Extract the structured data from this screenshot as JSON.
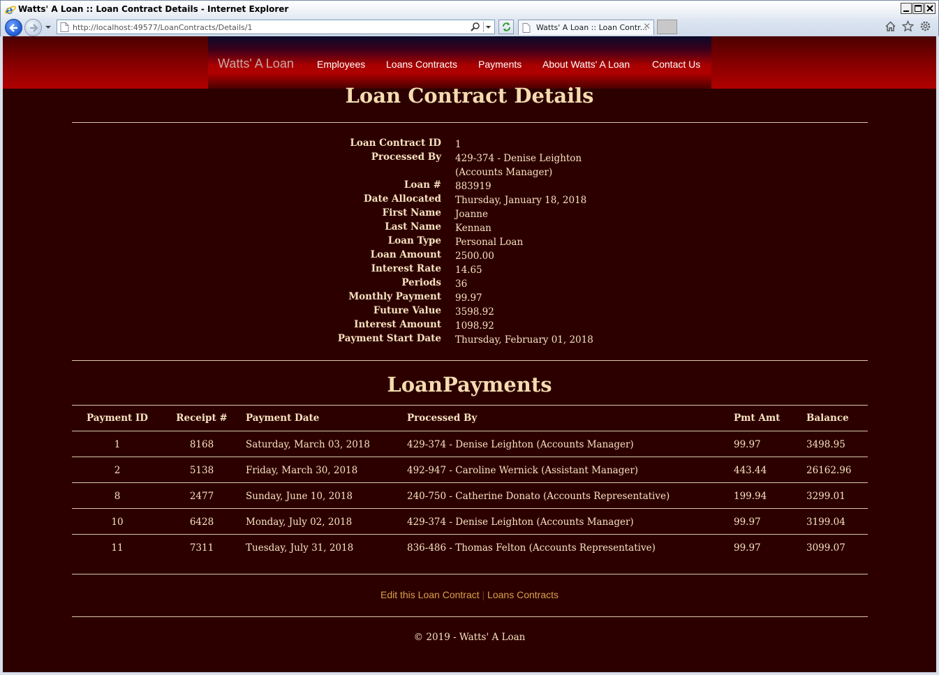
{
  "window": {
    "title": "Watts' A Loan :: Loan Contract Details - Internet Explorer",
    "url": "http://localhost:49577/LoanContracts/Details/1",
    "tab_title": "Watts' A Loan :: Loan Contr...",
    "tab_close": "✕"
  },
  "nav": {
    "brand": "Watts' A Loan",
    "items": [
      {
        "label": "Employees"
      },
      {
        "label": "Loans Contracts"
      },
      {
        "label": "Payments"
      },
      {
        "label": "About Watts' A Loan"
      },
      {
        "label": "Contact Us"
      }
    ]
  },
  "details": {
    "title": "Loan Contract Details",
    "fields": [
      {
        "label": "Loan Contract ID",
        "value": "1"
      },
      {
        "label": "Processed By",
        "value": "429-374 - Denise Leighton",
        "value2": "(Accounts Manager)"
      },
      {
        "label": "Loan #",
        "value": "883919"
      },
      {
        "label": "Date Allocated",
        "value": "Thursday, January 18, 2018"
      },
      {
        "label": "First Name",
        "value": "Joanne"
      },
      {
        "label": "Last Name",
        "value": "Kennan"
      },
      {
        "label": "Loan Type",
        "value": "Personal Loan"
      },
      {
        "label": "Loan Amount",
        "value": "2500.00"
      },
      {
        "label": "Interest Rate",
        "value": "14.65"
      },
      {
        "label": "Periods",
        "value": "36"
      },
      {
        "label": "Monthly Payment",
        "value": "99.97"
      },
      {
        "label": "Future Value",
        "value": "3598.92"
      },
      {
        "label": "Interest Amount",
        "value": "1098.92"
      },
      {
        "label": "Payment Start Date",
        "value": "Thursday, February 01, 2018"
      }
    ]
  },
  "payments": {
    "title": "LoanPayments",
    "headers": {
      "id": "Payment ID",
      "receipt": "Receipt #",
      "date": "Payment Date",
      "processed_by": "Processed By",
      "amount": "Pmt Amt",
      "balance": "Balance"
    },
    "rows": [
      {
        "id": "1",
        "receipt": "8168",
        "date": "Saturday, March 03, 2018",
        "processed_by": "429-374 - Denise Leighton (Accounts Manager)",
        "amount": "99.97",
        "balance": "3498.95"
      },
      {
        "id": "2",
        "receipt": "5138",
        "date": "Friday, March 30, 2018",
        "processed_by": "492-947 - Caroline Wernick (Assistant Manager)",
        "amount": "443.44",
        "balance": "26162.96"
      },
      {
        "id": "8",
        "receipt": "2477",
        "date": "Sunday, June 10, 2018",
        "processed_by": "240-750 - Catherine Donato (Accounts Representative)",
        "amount": "199.94",
        "balance": "3299.01"
      },
      {
        "id": "10",
        "receipt": "6428",
        "date": "Monday, July 02, 2018",
        "processed_by": "429-374 - Denise Leighton (Accounts Manager)",
        "amount": "99.97",
        "balance": "3199.04"
      },
      {
        "id": "11",
        "receipt": "7311",
        "date": "Tuesday, July 31, 2018",
        "processed_by": "836-486 - Thomas Felton (Accounts Representative)",
        "amount": "99.97",
        "balance": "3099.07"
      }
    ]
  },
  "footer": {
    "edit_link": "Edit this Loan Contract",
    "separator": "|",
    "list_link": "Loans Contracts",
    "copyright": "© 2019 - Watts' A Loan"
  }
}
